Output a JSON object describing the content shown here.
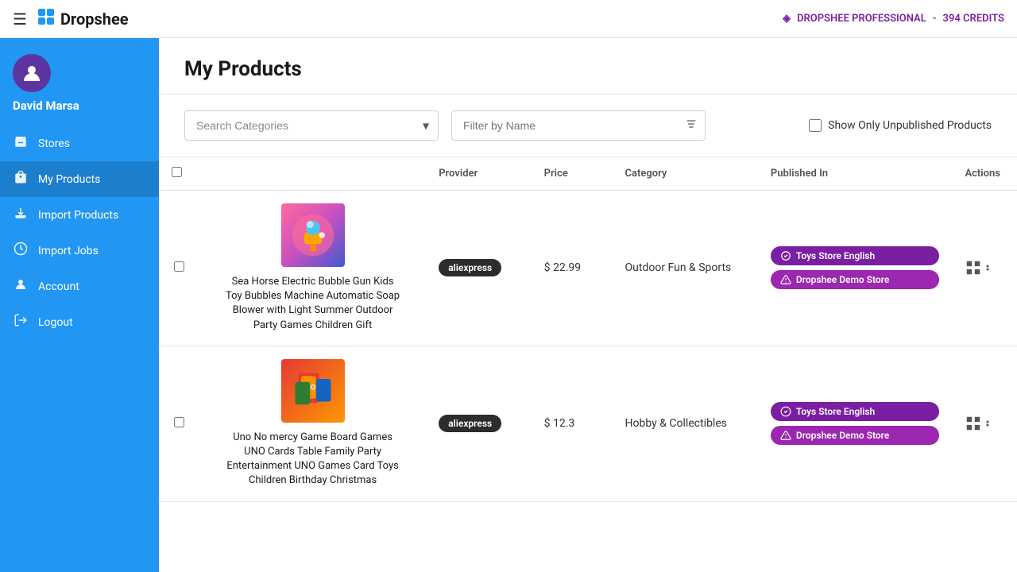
{
  "topbar": {
    "menu_icon": "☰",
    "logo_icon": "⊞",
    "logo_text": "Dropshee",
    "plan_icon": "◈",
    "plan_text": "DROPSHEE PROFESSIONAL",
    "credits": "394 CREDITS"
  },
  "sidebar": {
    "username": "David Marsa",
    "avatar_icon": "👤",
    "items": [
      {
        "id": "stores",
        "label": "Stores",
        "icon": "🏪"
      },
      {
        "id": "my-products",
        "label": "My Products",
        "icon": "🛍"
      },
      {
        "id": "import-products",
        "label": "Import Products",
        "icon": "⬆"
      },
      {
        "id": "import-jobs",
        "label": "Import Jobs",
        "icon": "⚙"
      },
      {
        "id": "account",
        "label": "Account",
        "icon": "👤"
      },
      {
        "id": "logout",
        "label": "Logout",
        "icon": "→"
      }
    ]
  },
  "main": {
    "title": "My Products",
    "filters": {
      "categories_placeholder": "Search Categories",
      "name_placeholder": "Filter by Name",
      "unpublished_label": "Show Only Unpublished Products"
    },
    "table": {
      "headers": [
        "",
        "",
        "Provider",
        "Price",
        "Category",
        "Published In",
        "Actions"
      ],
      "rows": [
        {
          "id": 1,
          "name": "Sea Horse Electric Bubble Gun Kids Toy Bubbles Machine Automatic Soap Blower with Light Summer Outdoor Party Games Children Gift",
          "image_emoji": "🔫",
          "image_bg": "bubble",
          "provider": "aliexpress",
          "price": "$ 22.99",
          "category": "Outdoor Fun & Sports",
          "published": [
            {
              "type": "verified",
              "label": "Toys Store English"
            },
            {
              "type": "warning",
              "label": "Dropshee Demo Store"
            }
          ]
        },
        {
          "id": 2,
          "name": "Uno No mercy Game Board Games UNO Cards Table Family Party Entertainment UNO Games Card Toys Children Birthday Christmas",
          "image_emoji": "🃏",
          "image_bg": "uno",
          "provider": "aliexpress",
          "price": "$ 12.3",
          "category": "Hobby & Collectibles",
          "published": [
            {
              "type": "verified",
              "label": "Toys Store English"
            },
            {
              "type": "warning",
              "label": "Dropshee Demo Store"
            }
          ]
        }
      ]
    }
  }
}
